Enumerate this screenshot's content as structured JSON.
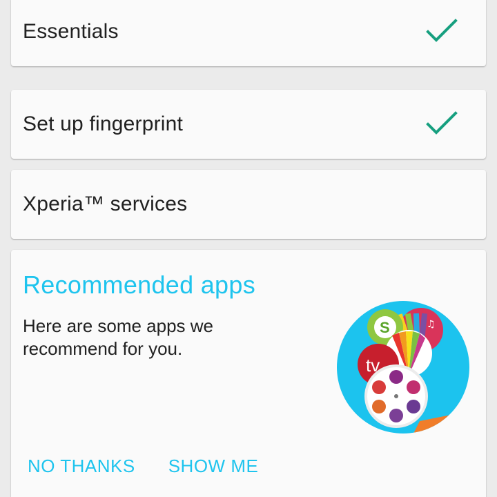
{
  "setup_list": {
    "items": [
      {
        "label": "Essentials",
        "completed": true
      },
      {
        "label": "Set up fingerprint",
        "completed": true
      },
      {
        "label": "Xperia™ services",
        "completed": false
      }
    ]
  },
  "recommended": {
    "title": "Recommended apps",
    "description": "Here are some apps we recommend for you.",
    "illustration_icons": [
      "shopping-s-icon",
      "lifelog-icon",
      "tv-sideview-icon",
      "video-reel-icon"
    ],
    "actions": {
      "no_thanks": "NO THANKS",
      "show_me": "SHOW ME"
    }
  },
  "colors": {
    "accent": "#1ec4ee",
    "check": "#169f7f",
    "card": "#fafafa",
    "background": "#ebebeb",
    "text": "#212121"
  }
}
